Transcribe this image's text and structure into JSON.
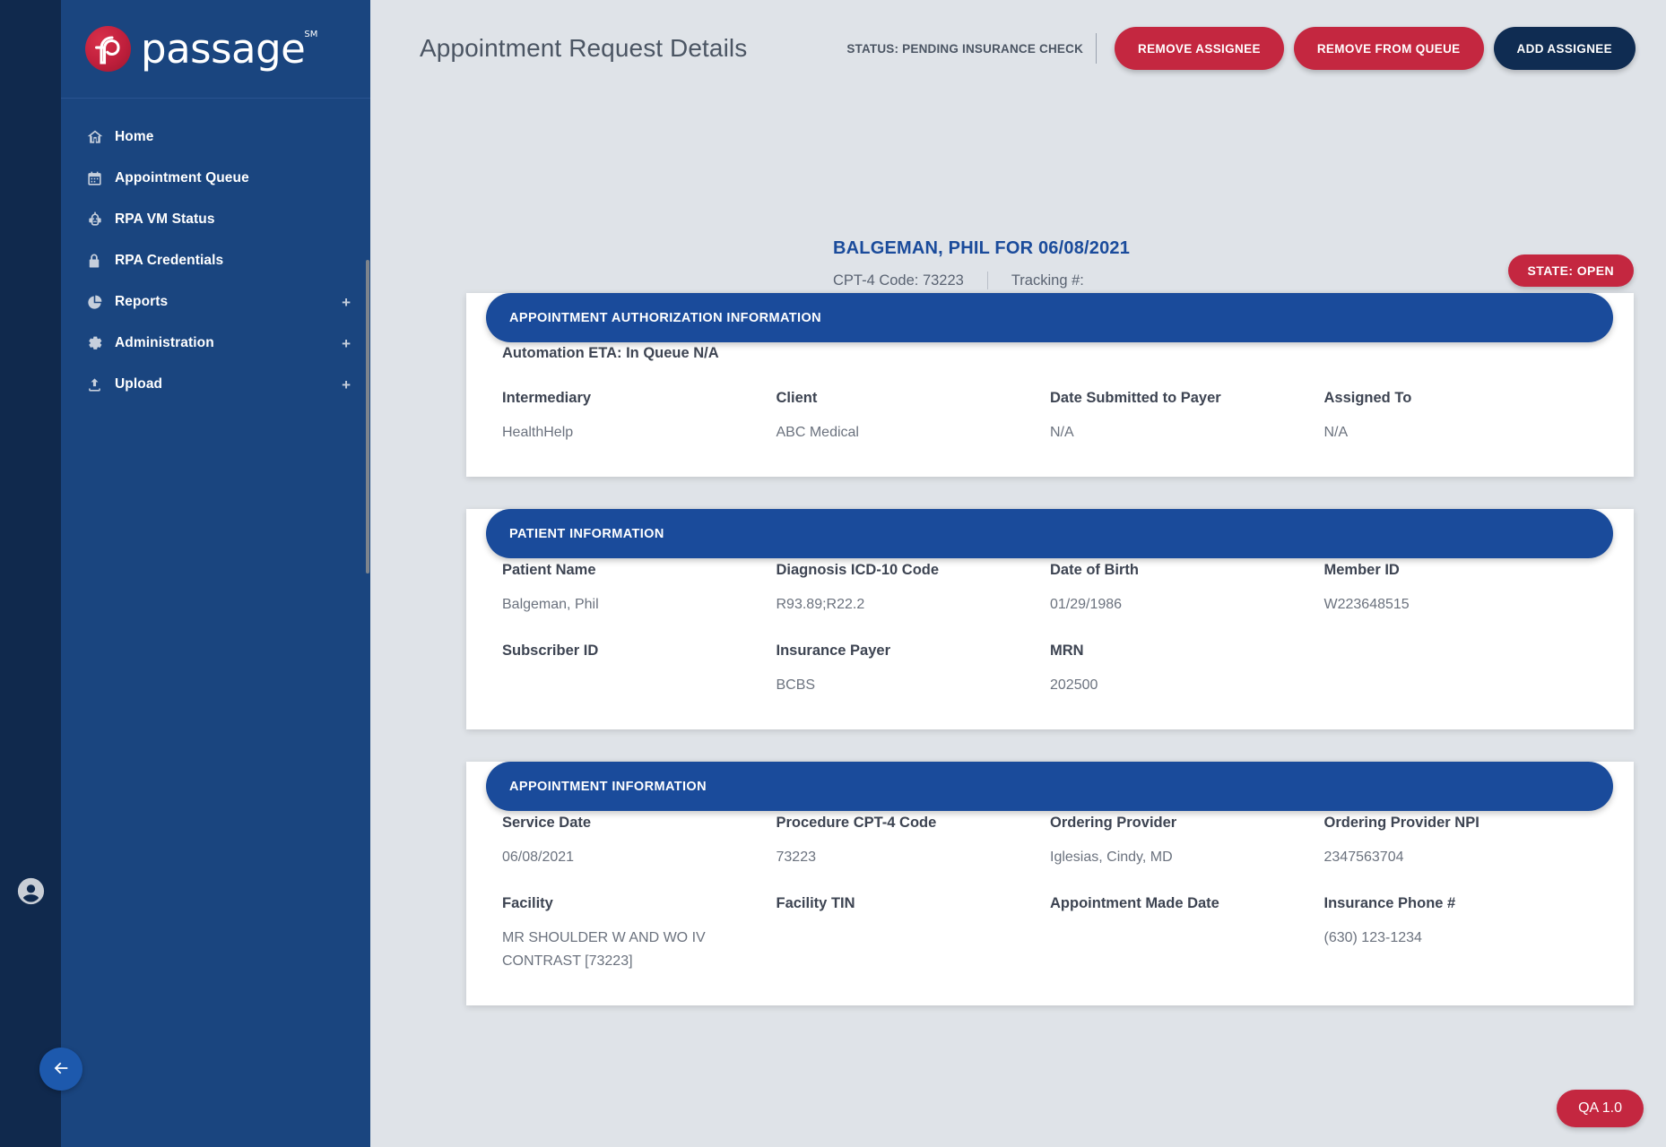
{
  "brand": {
    "name": "passage",
    "trademark": "SM",
    "logo_color": "#c01f3c",
    "sidebar_color": "#1a457f",
    "rail_color": "#10294d"
  },
  "sidebar": {
    "items": [
      {
        "label": "Home",
        "icon": "home-icon",
        "expandable": false
      },
      {
        "label": "Appointment Queue",
        "icon": "calendar-icon",
        "expandable": false
      },
      {
        "label": "RPA VM Status",
        "icon": "robot-icon",
        "expandable": false
      },
      {
        "label": "RPA Credentials",
        "icon": "lock-icon",
        "expandable": false
      },
      {
        "label": "Reports",
        "icon": "pie-chart-icon",
        "expandable": true,
        "expand_symbol": "+"
      },
      {
        "label": "Administration",
        "icon": "gear-icon",
        "expandable": true,
        "expand_symbol": "+"
      },
      {
        "label": "Upload",
        "icon": "upload-icon",
        "expandable": true,
        "expand_symbol": "+"
      }
    ],
    "account_icon": "user-account-icon",
    "back_icon": "arrow-left-icon"
  },
  "header": {
    "title": "Appointment Request Details",
    "status": "STATUS: PENDING INSURANCE CHECK",
    "buttons": [
      {
        "label": "REMOVE ASSIGNEE",
        "style": "red"
      },
      {
        "label": "REMOVE FROM QUEUE",
        "style": "red"
      },
      {
        "label": "ADD ASSIGNEE",
        "style": "navy"
      }
    ],
    "accent_red": "#c42740",
    "accent_navy": "#0f2c52"
  },
  "record": {
    "title": "BALGEMAN, PHIL FOR 06/08/2021",
    "cpt_label": "CPT-4 Code: 73223",
    "tracking_label": "Tracking #:",
    "state_badge": "STATE: OPEN"
  },
  "cards": [
    {
      "title": "APPOINTMENT AUTHORIZATION INFORMATION",
      "eta": "Automation ETA: In Queue N/A",
      "rows": [
        [
          {
            "label": "Intermediary",
            "value": "HealthHelp"
          },
          {
            "label": "Client",
            "value": "ABC Medical"
          },
          {
            "label": "Date Submitted to Payer",
            "value": "N/A"
          },
          {
            "label": "Assigned To",
            "value": "N/A"
          }
        ]
      ]
    },
    {
      "title": "PATIENT INFORMATION",
      "eta": "",
      "rows": [
        [
          {
            "label": "Patient Name",
            "value": "Balgeman, Phil"
          },
          {
            "label": "Diagnosis ICD-10 Code",
            "value": "R93.89;R22.2"
          },
          {
            "label": "Date of Birth",
            "value": "01/29/1986"
          },
          {
            "label": "Member ID",
            "value": "W223648515"
          }
        ],
        [
          {
            "label": "Subscriber ID",
            "value": ""
          },
          {
            "label": "Insurance Payer",
            "value": "BCBS"
          },
          {
            "label": "MRN",
            "value": "202500"
          },
          {
            "label": "",
            "value": ""
          }
        ]
      ]
    },
    {
      "title": "APPOINTMENT INFORMATION",
      "eta": "",
      "rows": [
        [
          {
            "label": "Service Date",
            "value": "06/08/2021"
          },
          {
            "label": "Procedure CPT-4 Code",
            "value": "73223"
          },
          {
            "label": "Ordering Provider",
            "value": "Iglesias, Cindy, MD"
          },
          {
            "label": "Ordering Provider NPI",
            "value": "2347563704"
          }
        ],
        [
          {
            "label": "Facility",
            "value": "MR SHOULDER W AND WO IV CONTRAST [73223]"
          },
          {
            "label": "Facility TIN",
            "value": ""
          },
          {
            "label": "Appointment Made Date",
            "value": ""
          },
          {
            "label": "Insurance Phone #",
            "value": "(630) 123-1234"
          }
        ]
      ]
    }
  ],
  "qa_badge": {
    "label": "QA 1.0"
  }
}
